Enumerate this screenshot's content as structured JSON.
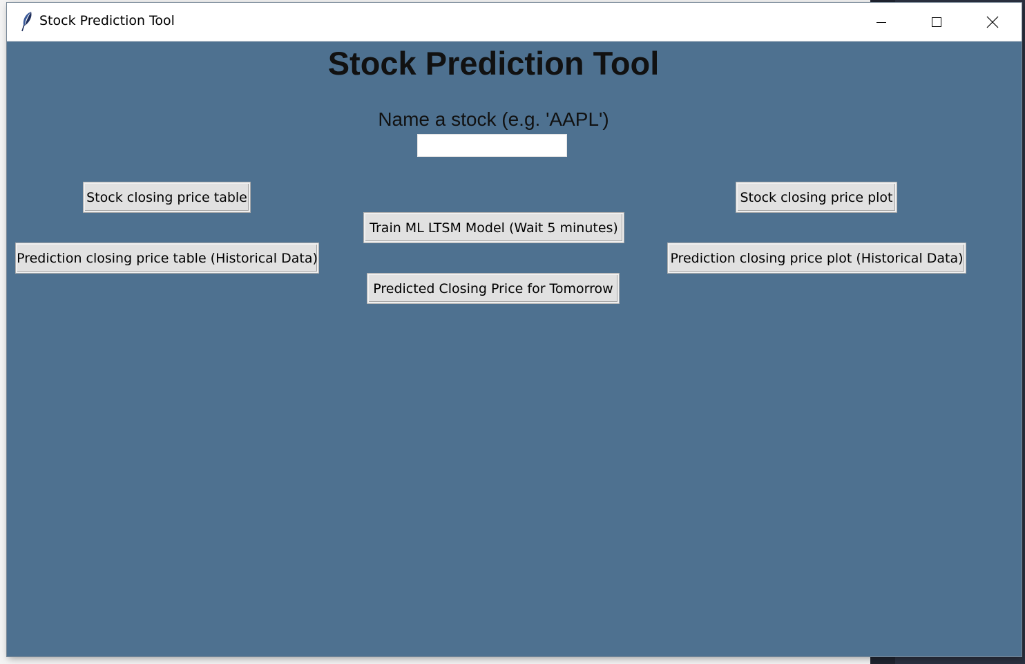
{
  "window": {
    "title": "Stock Prediction Tool",
    "app_icon": "feather-icon",
    "controls": {
      "minimize_icon": "minimize-icon",
      "maximize_icon": "maximize-icon",
      "close_icon": "close-icon"
    }
  },
  "colors": {
    "background": "#4e7190",
    "button_face": "#e1e1e1",
    "titlebar": "#ffffff"
  },
  "main": {
    "heading": "Stock Prediction Tool",
    "prompt": "Name a stock (e.g. 'AAPL')",
    "stock_input": {
      "value": "",
      "placeholder": ""
    },
    "buttons": {
      "closing_price_table": "Stock closing price table",
      "closing_price_plot": "Stock closing price plot",
      "train_model": "Train ML LTSM Model (Wait 5 minutes)",
      "prediction_table": "Prediction closing price table (Historical Data)",
      "prediction_plot": "Prediction closing price plot (Historical Data)",
      "predict_tomorrow": "Predicted Closing Price for Tomorrow"
    }
  }
}
